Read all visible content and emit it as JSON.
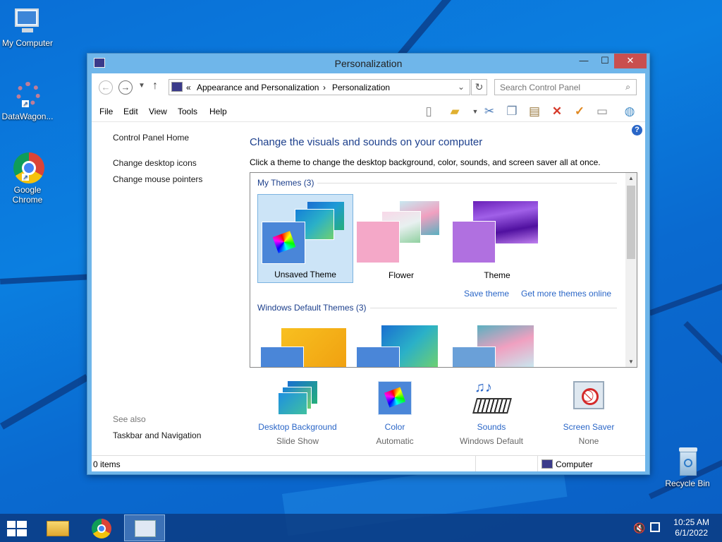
{
  "desktop": {
    "icons": [
      {
        "label": "My Computer",
        "icon": "computer-icon"
      },
      {
        "label": "DataWagon...",
        "icon": "gear-shortcut-icon"
      },
      {
        "label": "Google Chrome",
        "icon": "chrome-icon"
      },
      {
        "label": "Recycle Bin",
        "icon": "recycle-bin-icon"
      }
    ]
  },
  "window": {
    "title": "Personalization",
    "buttons": {
      "minimize": "—",
      "maximize": "☐",
      "close": "✕"
    },
    "breadcrumb": {
      "sep_start": "«",
      "parent": "Appearance and Personalization",
      "sep": "›",
      "current": "Personalization"
    },
    "search_placeholder": "Search Control Panel",
    "menus": [
      "File",
      "Edit",
      "View",
      "Tools",
      "Help"
    ],
    "left": {
      "home": "Control Panel Home",
      "links": [
        "Change desktop icons",
        "Change mouse pointers"
      ],
      "see_also_label": "See also",
      "see_also_links": [
        "Taskbar and Navigation"
      ]
    },
    "main": {
      "heading": "Change the visuals and sounds on your computer",
      "subtext": "Click a theme to change the desktop background, color, sounds, and screen saver all at once.",
      "my_themes_label": "My Themes (3)",
      "my_themes": [
        {
          "name": "Unsaved Theme",
          "selected": true
        },
        {
          "name": "Flower",
          "selected": false
        },
        {
          "name": "Theme",
          "selected": false
        }
      ],
      "save_theme": "Save theme",
      "get_more": "Get more themes online",
      "default_themes_label": "Windows Default Themes (3)",
      "bottom": [
        {
          "label": "Desktop Background",
          "value": "Slide Show",
          "icon": "desktop-background-icon"
        },
        {
          "label": "Color",
          "value": "Automatic",
          "icon": "color-icon"
        },
        {
          "label": "Sounds",
          "value": "Windows Default",
          "icon": "sounds-icon"
        },
        {
          "label": "Screen Saver",
          "value": "None",
          "icon": "screen-saver-icon"
        }
      ]
    },
    "status": {
      "items": "0 items",
      "location": "Computer"
    }
  },
  "taskbar": {
    "time": "10:25 AM",
    "date": "6/1/2022"
  }
}
